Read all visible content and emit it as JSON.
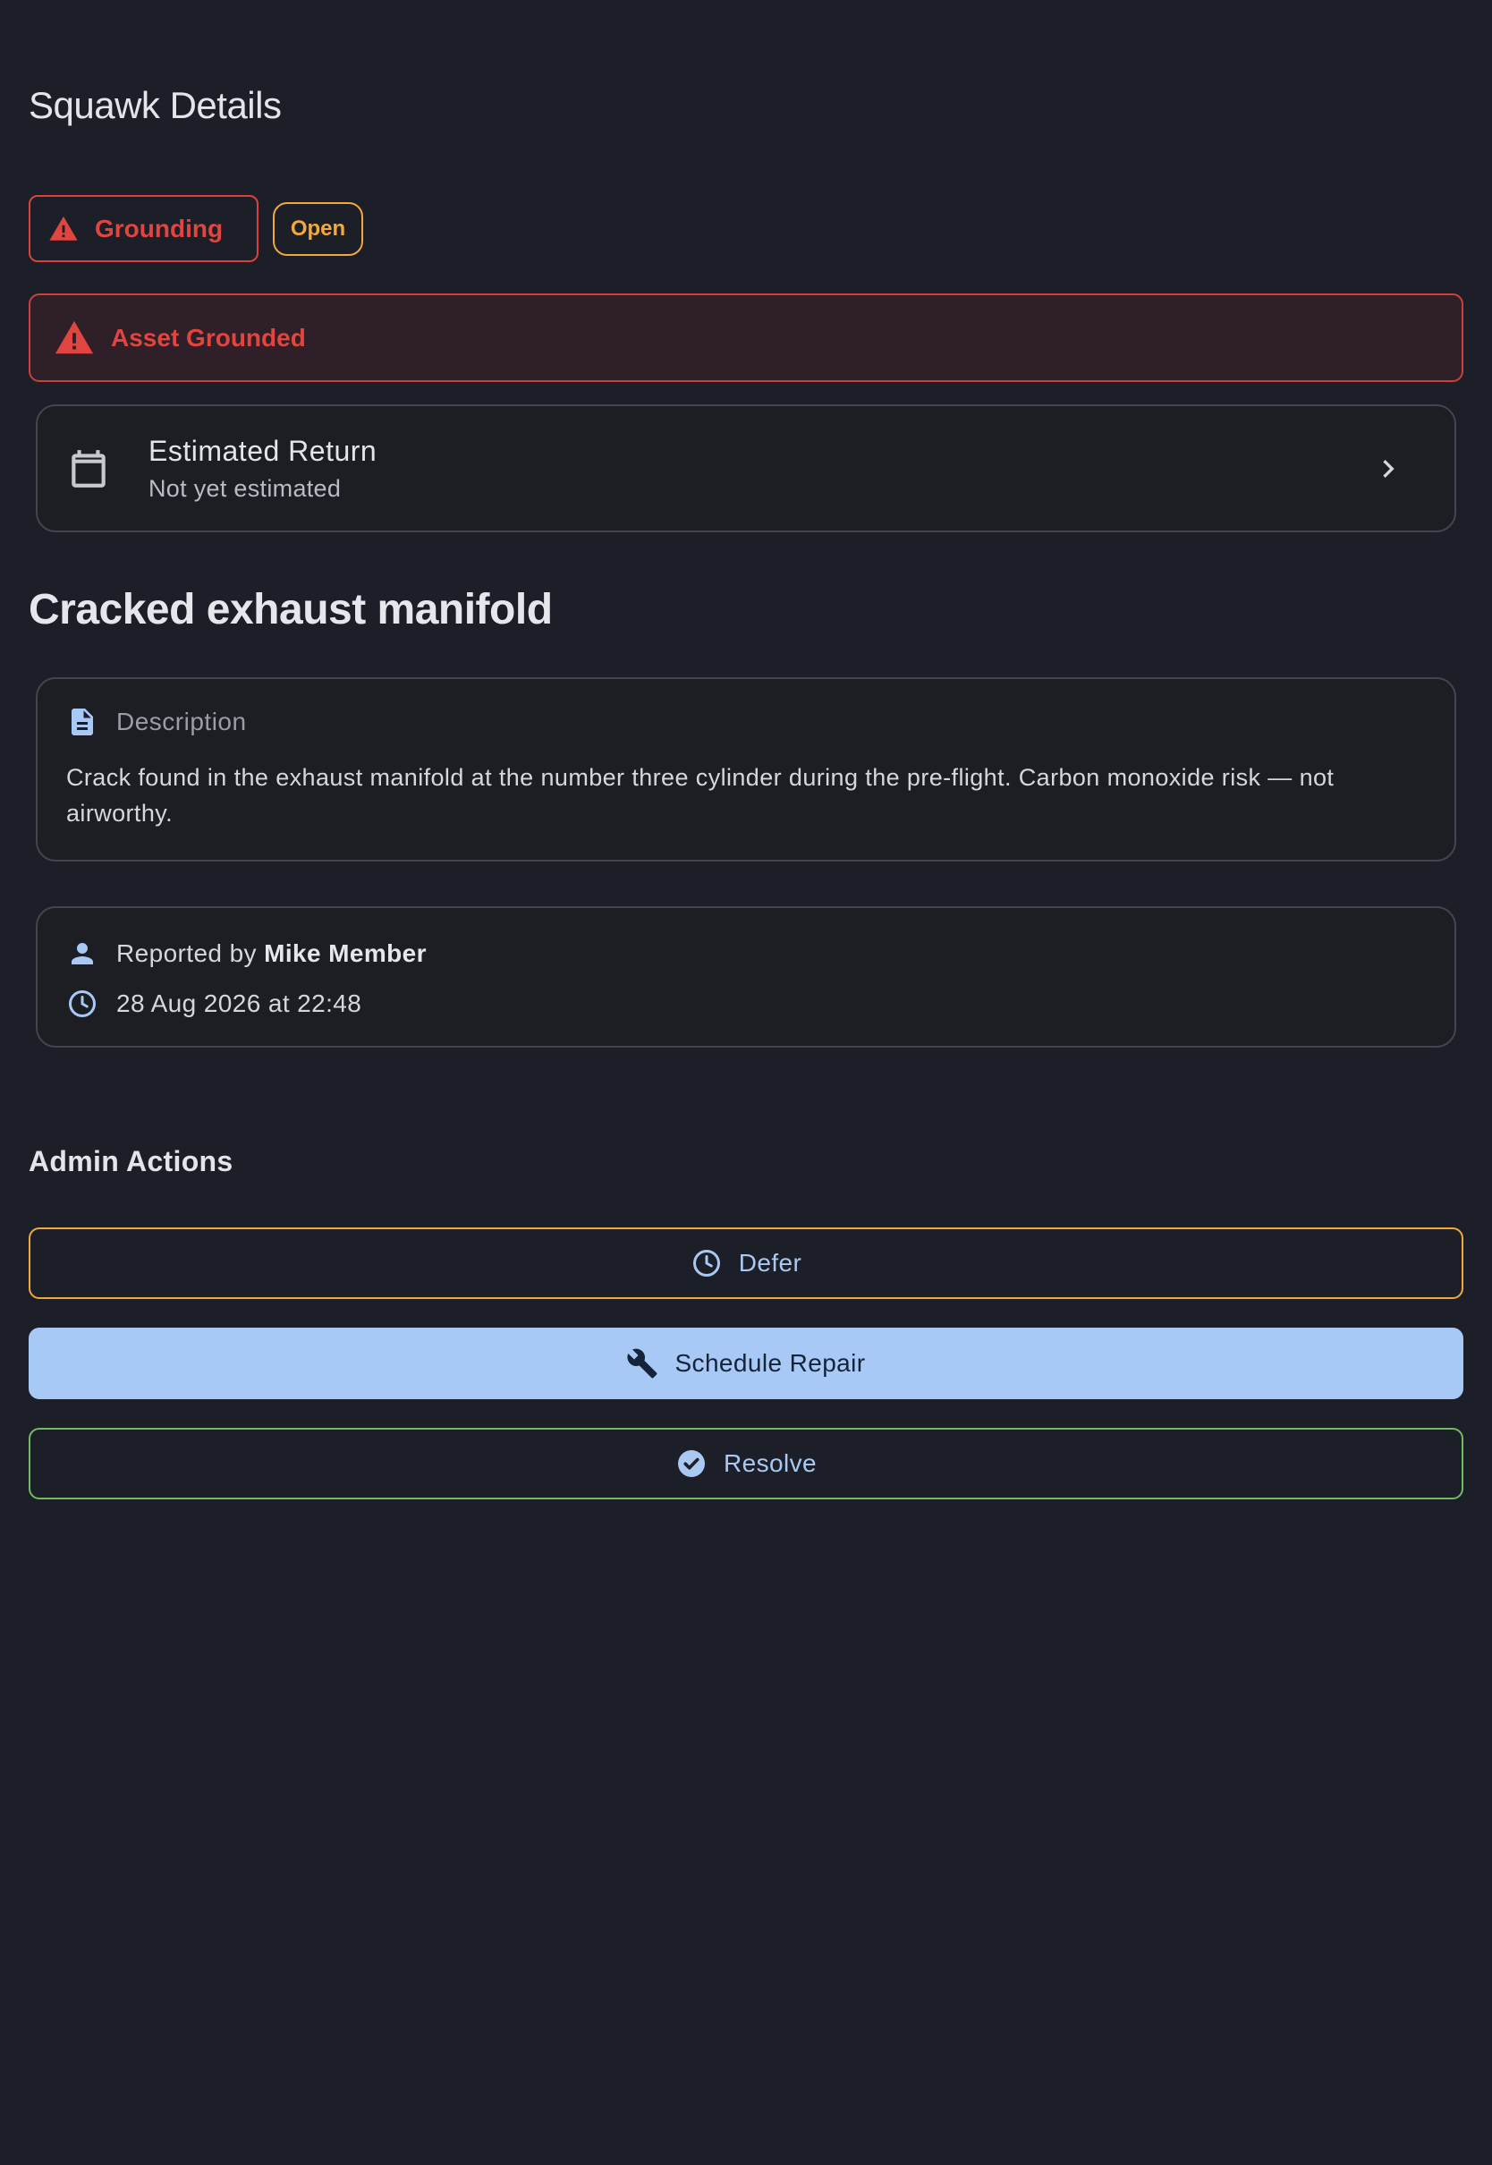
{
  "app": {
    "title": "Squawk Details"
  },
  "status": {
    "severity_label": "Grounding",
    "state_label": "Open"
  },
  "banner": {
    "text": "Asset Grounded"
  },
  "estimated_return": {
    "title": "Estimated Return",
    "value": "Not yet estimated"
  },
  "squawk": {
    "title": "Cracked exhaust manifold",
    "description_label": "Description",
    "description": "Crack found in the exhaust manifold at the number three cylinder during the pre-flight. Carbon monoxide risk — not airworthy."
  },
  "meta": {
    "reported_prefix": "Reported by ",
    "reporter": "Mike Member",
    "timestamp": "28 Aug 2026 at 22:48"
  },
  "admin": {
    "title": "Admin Actions",
    "defer_label": "Defer",
    "repair_label": "Schedule Repair",
    "resolve_label": "Resolve"
  },
  "colors": {
    "background": "#1c1f27",
    "danger": "#e0453f",
    "warning": "#f2a93b",
    "primary": "#a8c8f5",
    "success": "#72bb63"
  },
  "icons": {
    "severity": "warning-triangle-icon",
    "banner": "warning-triangle-icon",
    "return": "calendar-icon",
    "return_nav": "chevron-right-icon",
    "description": "document-icon",
    "reporter": "person-icon",
    "timestamp": "clock-icon",
    "defer": "clock-icon",
    "repair": "wrench-icon",
    "resolve": "check-circle-icon"
  }
}
